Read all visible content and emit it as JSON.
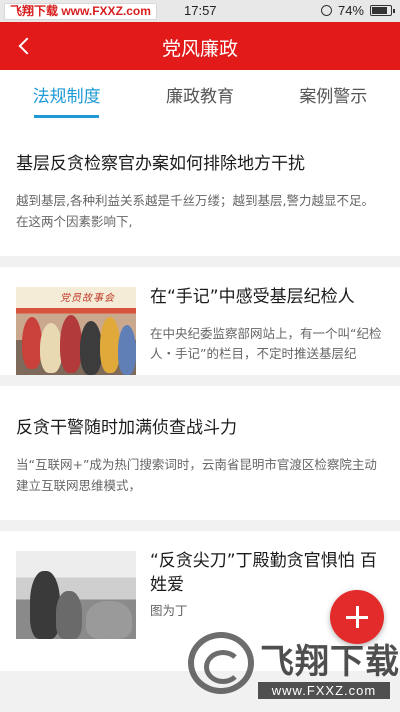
{
  "status_bar": {
    "watermark": "飞翔下载 www.FXXZ.com",
    "time": "17:57",
    "battery": "74%",
    "battery_level": 0.74
  },
  "header": {
    "title": "党风廉政"
  },
  "tabs": [
    {
      "label": "法规制度",
      "active": true
    },
    {
      "label": "廉政教育",
      "active": false
    },
    {
      "label": "案例警示",
      "active": false
    }
  ],
  "articles": [
    {
      "title": "基层反贪检察官办案如何排除地方干扰",
      "summary": "越到基层,各种利益关系越是千丝万缕；越到基层,警力越显不足。在这两个因素影响下,",
      "has_image": false
    },
    {
      "title": "在“手记”中感受基层纪检人",
      "summary": "在中央纪委监察部网站上，有一个叫“纪检人・手记”的栏目，不定时推送基层纪",
      "has_image": true,
      "image_caption": "党员故事会"
    },
    {
      "title": "反贪干警随时加满侦查战斗力",
      "summary": "当“互联网+”成为热门搜索词时，云南省昆明市官渡区检察院主动建立互联网思维模式，",
      "has_image": false
    },
    {
      "title": "“反贪尖刀”丁殿勤贪官惧怕 百姓爱",
      "summary": "图为丁",
      "has_image": true
    }
  ],
  "fab": {
    "icon": "plus-icon"
  },
  "watermark": {
    "text": "飞翔下载",
    "url": "www.FXXZ.com"
  },
  "colors": {
    "header_red": "#e21a1a",
    "tab_active": "#1e9ad6",
    "fab_red": "#e42b2b"
  }
}
